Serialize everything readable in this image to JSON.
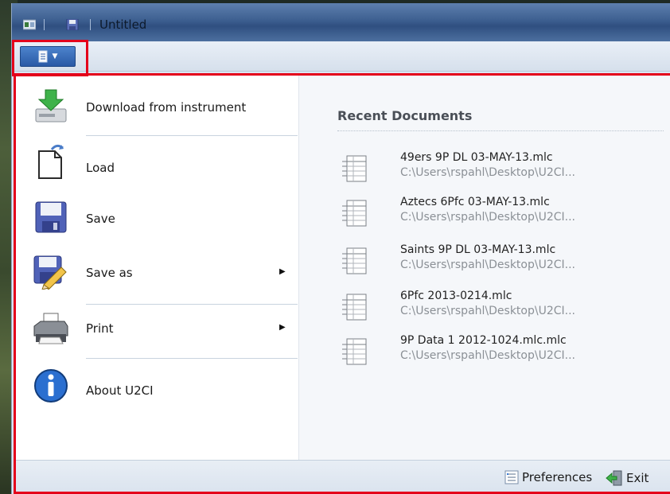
{
  "window": {
    "title": "Untitled"
  },
  "app_menu_button": {
    "icon": "document-menu-icon"
  },
  "menu": {
    "items": [
      {
        "label": "Download from instrument",
        "icon": "download-icon",
        "has_submenu": false
      },
      {
        "label": "Load",
        "icon": "load-icon",
        "has_submenu": false
      },
      {
        "label": "Save",
        "icon": "floppy-save-icon",
        "has_submenu": false
      },
      {
        "label": "Save as",
        "icon": "save-as-icon",
        "has_submenu": true
      },
      {
        "label": "Print",
        "icon": "printer-icon",
        "has_submenu": true
      },
      {
        "label": "About U2CI",
        "icon": "info-icon",
        "has_submenu": false
      }
    ]
  },
  "recent": {
    "title": "Recent Documents",
    "documents": [
      {
        "name": "49ers  9P DL 03-MAY-13.mlc",
        "path": "C:\\Users\\rspahl\\Desktop\\U2CI..."
      },
      {
        "name": "Aztecs 6Pfc 03-MAY-13.mlc",
        "path": "C:\\Users\\rspahl\\Desktop\\U2CI..."
      },
      {
        "name": "Saints 9P DL 03-MAY-13.mlc",
        "path": "C:\\Users\\rspahl\\Desktop\\U2CI..."
      },
      {
        "name": "6Pfc 2013-0214.mlc",
        "path": "C:\\Users\\rspahl\\Desktop\\U2CI..."
      },
      {
        "name": "9P Data 1 2012-1024.mlc.mlc",
        "path": "C:\\Users\\rspahl\\Desktop\\U2CI..."
      }
    ]
  },
  "footer": {
    "preferences_label": "Preferences",
    "exit_label": "Exit"
  },
  "colors": {
    "highlight_border": "#e4001b",
    "app_button": "#2a5aa6"
  }
}
